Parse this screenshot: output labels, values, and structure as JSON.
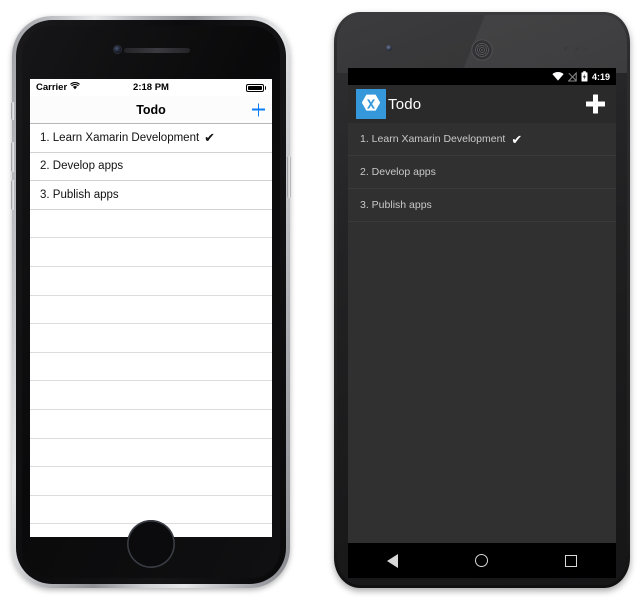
{
  "ios": {
    "device": "iphone",
    "status": {
      "carrier": "Carrier",
      "wifi_icon": "wifi-icon",
      "time": "2:18 PM",
      "battery_icon": "battery-full-icon"
    },
    "nav": {
      "title": "Todo",
      "add_label": "+",
      "add_icon": "plus-icon",
      "accent_color": "#0b7cf7"
    },
    "list": {
      "items": [
        {
          "text": "1. Learn Xamarin Development",
          "done": true,
          "check": "✔"
        },
        {
          "text": "2. Develop apps",
          "done": false,
          "check": ""
        },
        {
          "text": "3. Publish apps",
          "done": false,
          "check": ""
        }
      ],
      "empty_rows": 12
    },
    "home_button": "home-button"
  },
  "android": {
    "device": "android",
    "status": {
      "wifi_icon": "wifi-icon",
      "signal_icon": "signal-off-icon",
      "battery_icon": "battery-charging-icon",
      "time": "4:19"
    },
    "bar": {
      "app_icon": "xamarin-logo-icon",
      "app_icon_color": "#3498db",
      "title": "Todo",
      "add_label": "+",
      "add_icon": "plus-icon"
    },
    "list": {
      "items": [
        {
          "text": "1. Learn Xamarin Development",
          "done": true,
          "check": "✔"
        },
        {
          "text": "2. Develop apps",
          "done": false,
          "check": ""
        },
        {
          "text": "3. Publish apps",
          "done": false,
          "check": ""
        }
      ],
      "background_color": "#303030"
    },
    "navbar": {
      "back_icon": "back-triangle-icon",
      "home_icon": "home-circle-icon",
      "recents_icon": "recents-square-icon"
    }
  }
}
